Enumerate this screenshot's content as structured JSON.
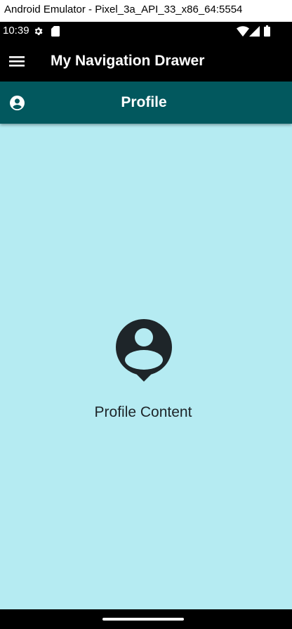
{
  "window": {
    "title": "Android Emulator - Pixel_3a_API_33_x86_64:5554"
  },
  "status_bar": {
    "time": "10:39",
    "left_icons": [
      "settings-icon",
      "sd-card-icon"
    ],
    "right_icons": [
      "wifi-icon",
      "cell-signal-icon",
      "battery-icon"
    ]
  },
  "app_bar": {
    "title": "My Navigation Drawer",
    "menu_icon": "hamburger-menu-icon"
  },
  "page_header": {
    "title": "Profile",
    "icon": "account-circle-icon"
  },
  "content": {
    "label": "Profile Content",
    "icon": "profile-pin-icon"
  },
  "colors": {
    "app_bar": "#000000",
    "page_header": "#02585e",
    "content_bg": "#b5ebf2",
    "content_icon": "#1e2529"
  }
}
